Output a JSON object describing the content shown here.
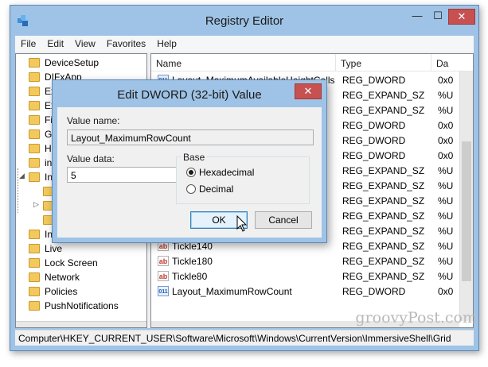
{
  "window": {
    "title": "Registry Editor",
    "controls": {
      "minimize": "—",
      "maximize": "☐",
      "close": "✕"
    }
  },
  "menu": [
    "File",
    "Edit",
    "View",
    "Favorites",
    "Help"
  ],
  "tree": {
    "items": [
      {
        "label": "DeviceSetup",
        "expander": ""
      },
      {
        "label": "DIFxApp",
        "expander": ""
      },
      {
        "label": "Ex",
        "expander": ""
      },
      {
        "label": "Ex",
        "expander": ""
      },
      {
        "label": "Fi",
        "expander": ""
      },
      {
        "label": "G",
        "expander": ""
      },
      {
        "label": "H",
        "expander": ""
      },
      {
        "label": "in",
        "expander": ""
      },
      {
        "label": "In",
        "expander": "◢"
      },
      {
        "label": "",
        "expander": ""
      },
      {
        "label": "",
        "expander": "▷"
      },
      {
        "label": "",
        "expander": ""
      },
      {
        "label": "In",
        "expander": ""
      },
      {
        "label": "Live",
        "expander": ""
      },
      {
        "label": "Lock Screen",
        "expander": ""
      },
      {
        "label": "Network",
        "expander": ""
      },
      {
        "label": "Policies",
        "expander": ""
      },
      {
        "label": "PushNotifications",
        "expander": ""
      }
    ]
  },
  "list": {
    "headers": {
      "name": "Name",
      "type": "Type",
      "data": "Da"
    },
    "rows": [
      {
        "name": "Layout_MaximumAvailableHeightCells",
        "type": "REG_DWORD",
        "data": "0x0",
        "icon": "dw"
      },
      {
        "name": "",
        "type": "REG_EXPAND_SZ",
        "data": "%U",
        "icon": "none"
      },
      {
        "name": "",
        "type": "REG_EXPAND_SZ",
        "data": "%U",
        "icon": "none"
      },
      {
        "name": "",
        "type": "REG_DWORD",
        "data": "0x0",
        "icon": "none"
      },
      {
        "name": "",
        "type": "REG_DWORD",
        "data": "0x0",
        "icon": "none"
      },
      {
        "name": "",
        "type": "REG_DWORD",
        "data": "0x0",
        "icon": "none"
      },
      {
        "name": "",
        "type": "REG_EXPAND_SZ",
        "data": "%U",
        "icon": "none"
      },
      {
        "name": "",
        "type": "REG_EXPAND_SZ",
        "data": "%U",
        "icon": "none"
      },
      {
        "name": "",
        "type": "REG_EXPAND_SZ",
        "data": "%U",
        "icon": "none"
      },
      {
        "name": "",
        "type": "REG_EXPAND_SZ",
        "data": "%U",
        "icon": "none"
      },
      {
        "name": "",
        "type": "REG_EXPAND_SZ",
        "data": "%U",
        "icon": "none"
      },
      {
        "name": "Tickle140",
        "type": "REG_EXPAND_SZ",
        "data": "%U",
        "icon": "sz"
      },
      {
        "name": "Tickle180",
        "type": "REG_EXPAND_SZ",
        "data": "%U",
        "icon": "sz"
      },
      {
        "name": "Tickle80",
        "type": "REG_EXPAND_SZ",
        "data": "%U",
        "icon": "sz"
      },
      {
        "name": "Layout_MaximumRowCount",
        "type": "REG_DWORD",
        "data": "0x0",
        "icon": "dw"
      }
    ],
    "icon_text": {
      "sz": "ab",
      "dw": "011"
    }
  },
  "status": {
    "path": "Computer\\HKEY_CURRENT_USER\\Software\\Microsoft\\Windows\\CurrentVersion\\ImmersiveShell\\Grid"
  },
  "watermark": "groovyPost.com",
  "dialog": {
    "title": "Edit DWORD (32-bit) Value",
    "close": "✕",
    "value_name_label": "Value name:",
    "value_name": "Layout_MaximumRowCount",
    "value_data_label": "Value data:",
    "value_data": "5",
    "base_label": "Base",
    "base_options": [
      {
        "label": "Hexadecimal",
        "selected": true
      },
      {
        "label": "Decimal",
        "selected": false
      }
    ],
    "ok_label": "OK",
    "cancel_label": "Cancel"
  }
}
